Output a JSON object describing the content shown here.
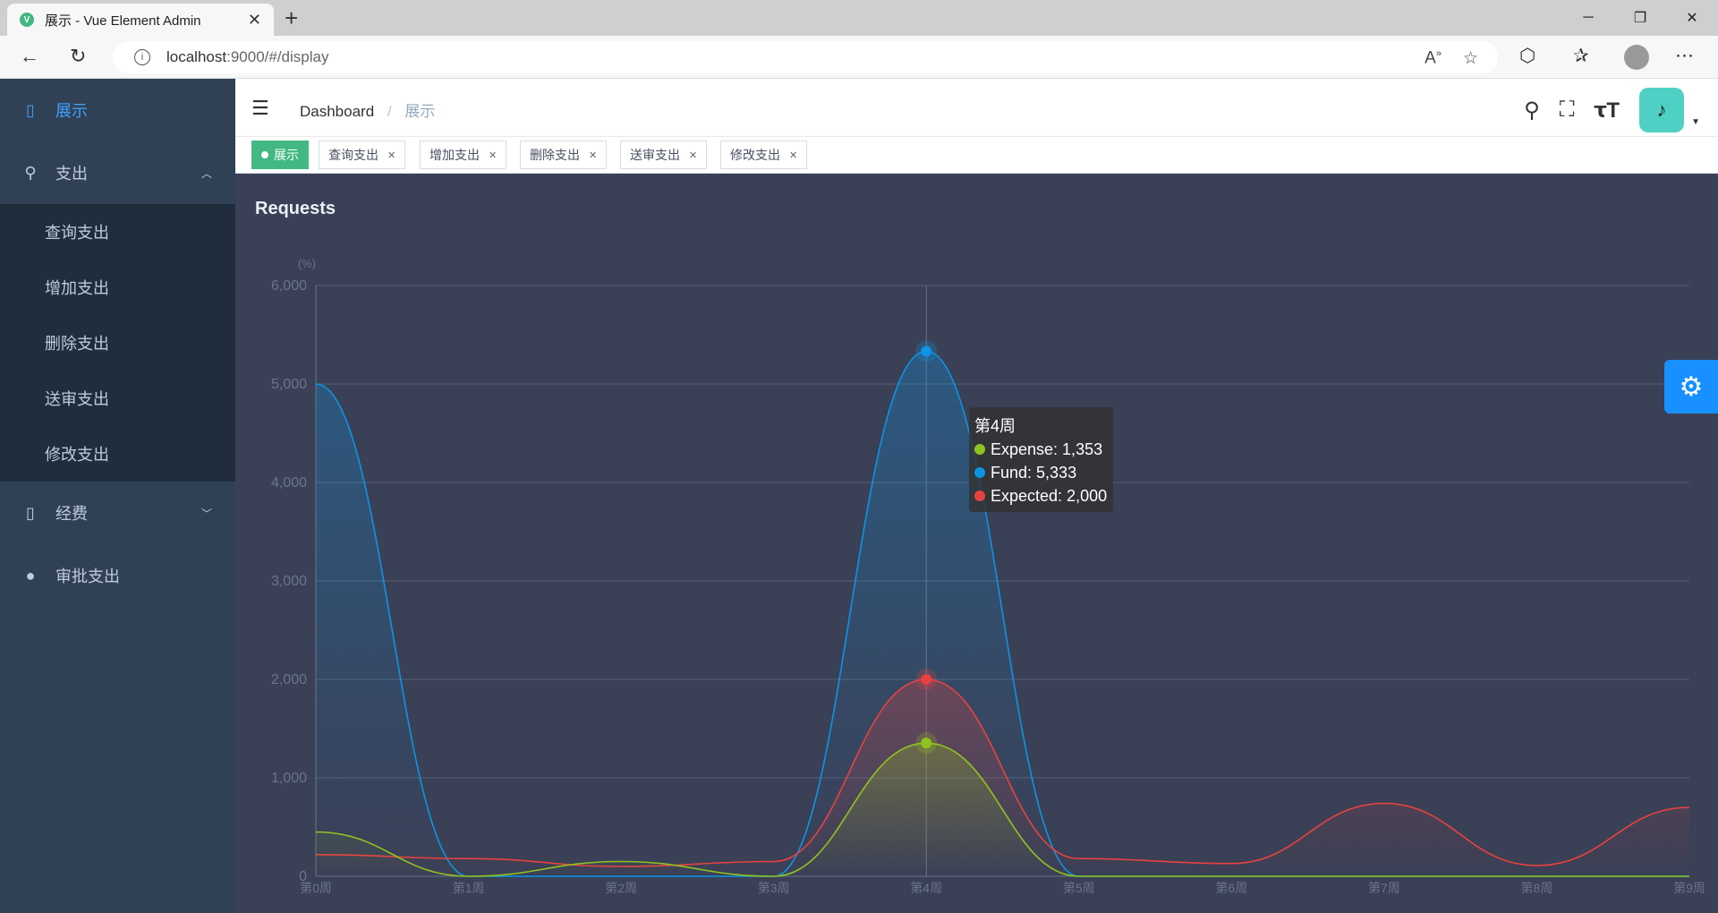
{
  "browser": {
    "tab_title": "展示 - Vue Element Admin",
    "favicon": "V",
    "url_host": "localhost",
    "url_rest": ":9000/#/display"
  },
  "sidebar": {
    "items": [
      {
        "label": "展示",
        "icon": "book-icon",
        "active": true
      },
      {
        "label": "支出",
        "icon": "search-icon",
        "expanded": true,
        "children": [
          {
            "label": "查询支出"
          },
          {
            "label": "增加支出"
          },
          {
            "label": "删除支出"
          },
          {
            "label": "送审支出"
          },
          {
            "label": "修改支出"
          }
        ]
      },
      {
        "label": "经费",
        "icon": "book-icon",
        "expanded": false
      },
      {
        "label": "审批支出",
        "icon": "user-icon"
      }
    ]
  },
  "header": {
    "breadcrumb": [
      "Dashboard",
      "展示"
    ]
  },
  "tags": [
    {
      "label": "展示",
      "active": true
    },
    {
      "label": "查询支出"
    },
    {
      "label": "增加支出"
    },
    {
      "label": "删除支出"
    },
    {
      "label": "送审支出"
    },
    {
      "label": "修改支出"
    }
  ],
  "panel": {
    "title": "Requests"
  },
  "tooltip": {
    "title": "第4周",
    "rows": [
      {
        "label": "Expense: 1,353",
        "color": "#8fc31f"
      },
      {
        "label": "Fund: 5,333",
        "color": "#0d94e5"
      },
      {
        "label": "Expected: 2,000",
        "color": "#e8423f"
      }
    ]
  },
  "chart_data": {
    "type": "area",
    "ylabel": "(%)",
    "ylim": [
      0,
      6000
    ],
    "yticks": [
      "0",
      "1,000",
      "2,000",
      "3,000",
      "4,000",
      "5,000",
      "6,000"
    ],
    "categories": [
      "第0周",
      "第1周",
      "第2周",
      "第3周",
      "第4周",
      "第5周",
      "第6周",
      "第7周",
      "第8周",
      "第9周"
    ],
    "series": [
      {
        "name": "Expense",
        "color": "#8fc31f",
        "values": [
          450,
          0,
          150,
          0,
          1353,
          0,
          0,
          0,
          0,
          0
        ]
      },
      {
        "name": "Fund",
        "color": "#0d94e5",
        "values": [
          5000,
          0,
          0,
          0,
          5333,
          0,
          0,
          0,
          0,
          0
        ]
      },
      {
        "name": "Expected",
        "color": "#e8423f",
        "values": [
          220,
          180,
          100,
          150,
          2000,
          180,
          130,
          740,
          110,
          700
        ]
      }
    ],
    "highlight_index": 4,
    "grid": true
  }
}
